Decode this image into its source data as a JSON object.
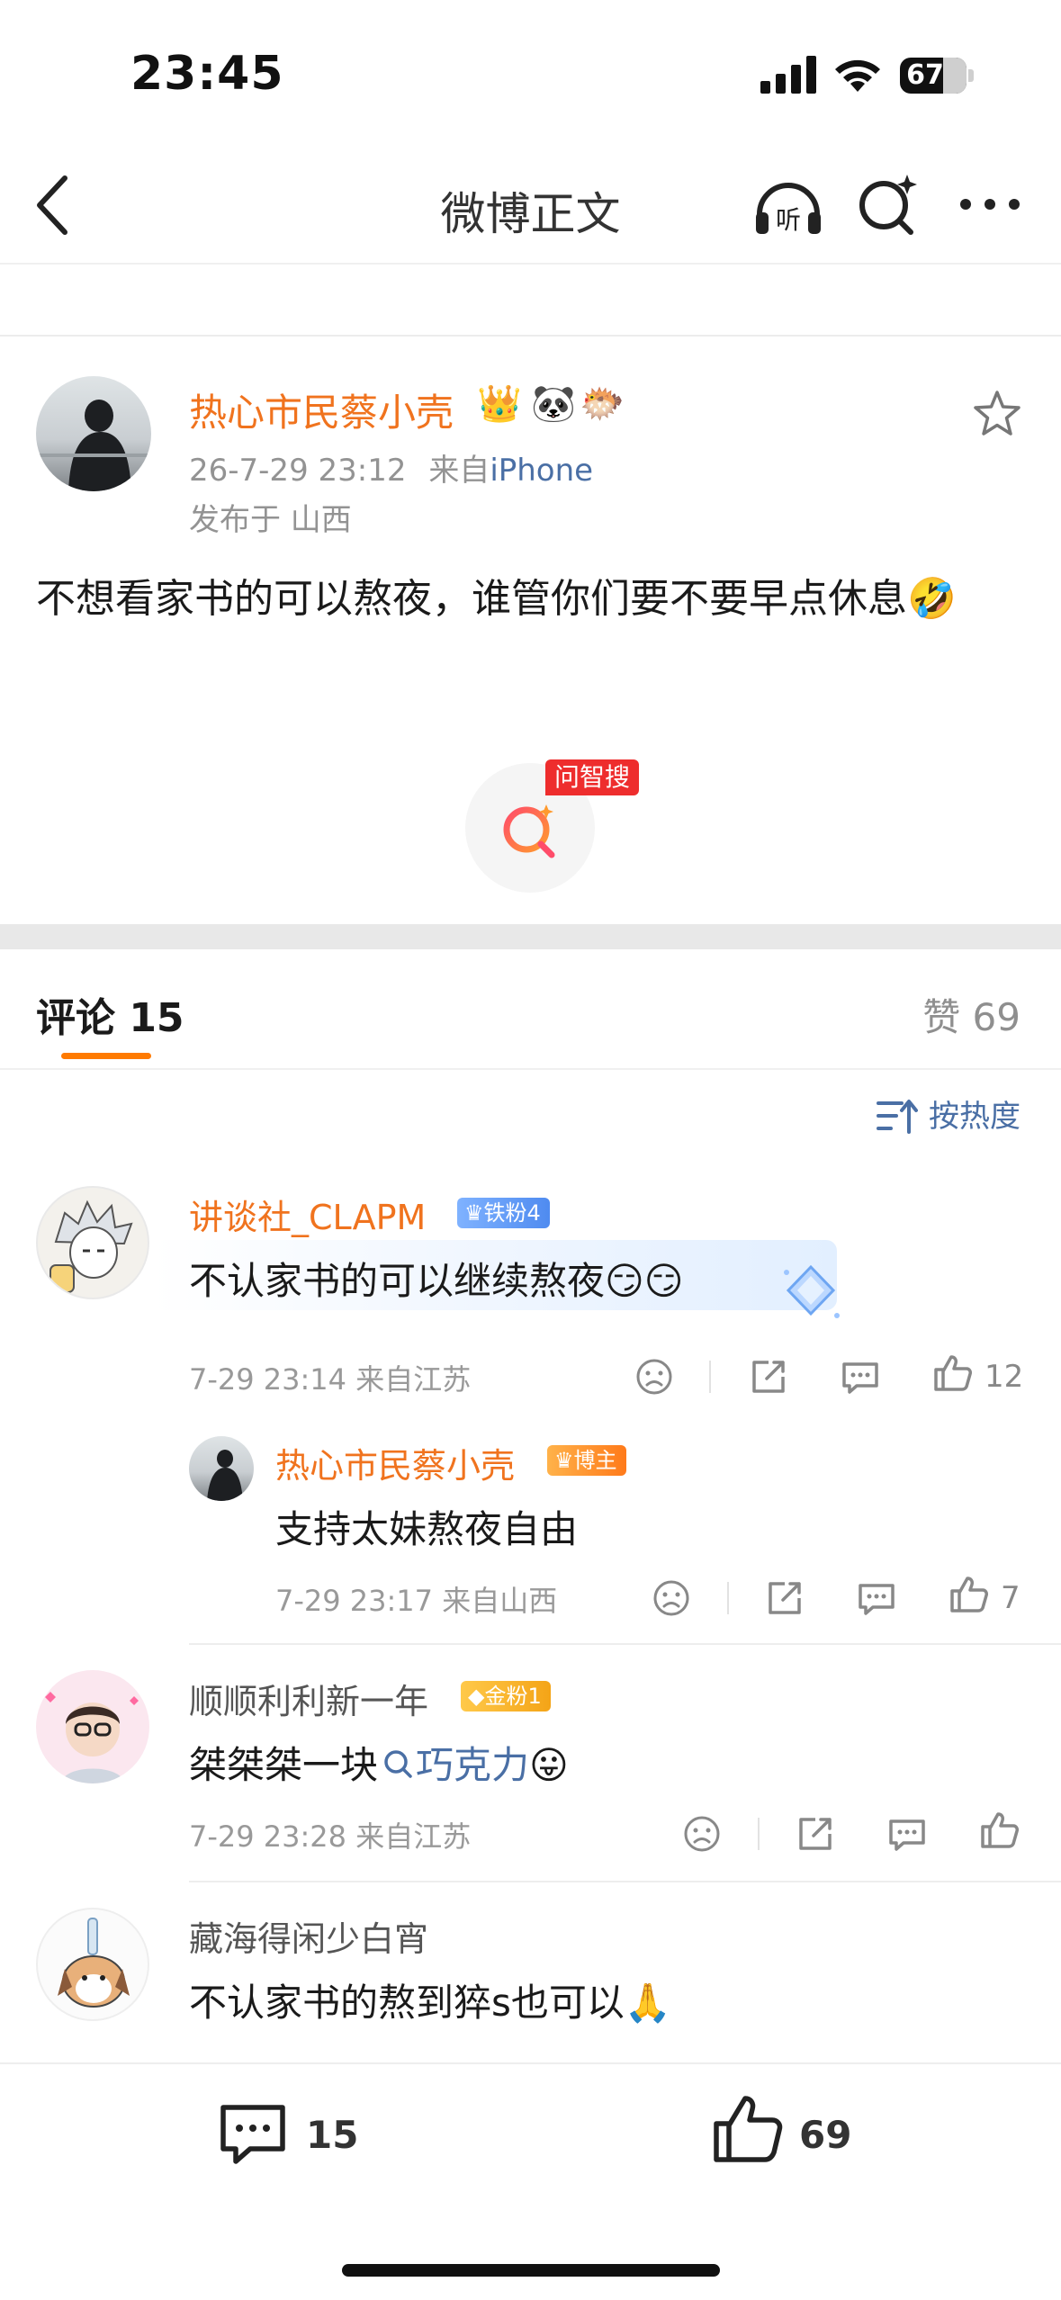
{
  "status_bar": {
    "time": "23:45",
    "battery": "67"
  },
  "nav": {
    "title": "微博正文"
  },
  "post": {
    "author": "热心市民蔡小壳",
    "badges": [
      "👑",
      "🐼",
      "🐡"
    ],
    "date": "26-7-29 23:12",
    "source_prefix": "来自",
    "source": "iPhone",
    "location": "发布于 山西",
    "text": "不想看家书的可以熬夜，谁管你们要不要早点休息🤣",
    "ai_tag": "问智搜"
  },
  "comments_header": {
    "tab_label": "评论 15",
    "likes_label": "赞 69",
    "sort_label": "按热度"
  },
  "comments": [
    {
      "name": "讲谈社_CLAPM",
      "badge": "铁粉4",
      "text": "不认家书的可以继续熬夜😏😏",
      "meta": "7-29 23:14  来自江苏",
      "likes": "12",
      "reply": {
        "name": "热心市民蔡小壳",
        "badge": "博主",
        "text": "支持太妹熬夜自由",
        "meta": "7-29 23:17  来自山西",
        "likes": "7"
      }
    },
    {
      "name": "顺顺利利新一年",
      "badge": "金粉1",
      "text_prefix": "桀桀桀一块",
      "link": "巧克力",
      "text_suffix": "😛",
      "meta": "7-29 23:28  来自江苏"
    },
    {
      "name": "藏海得闲少白宵",
      "text": "不认家书的熬到猝s也可以🙏"
    }
  ],
  "bottom_bar": {
    "comments": "15",
    "likes": "69"
  },
  "colors": {
    "accent": "#f0731e",
    "link": "#4a6fa5",
    "ai_tag": "#ee2d2d",
    "tab_underline": "#ff7a00"
  }
}
